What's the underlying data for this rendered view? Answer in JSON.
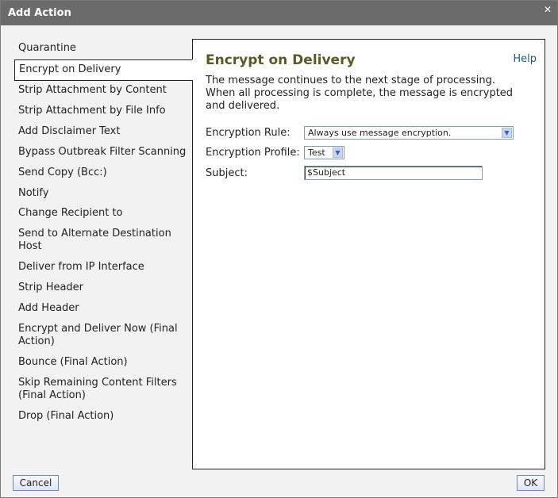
{
  "dialog": {
    "title": "Add Action",
    "close_glyph": "✕"
  },
  "menu": {
    "items": [
      "Quarantine",
      "Encrypt on Delivery",
      "Strip Attachment by Content",
      "Strip Attachment by File Info",
      "Add Disclaimer Text",
      "Bypass Outbreak Filter Scanning",
      "Send Copy (Bcc:)",
      "Notify",
      "Change Recipient to",
      "Send to Alternate Destination Host",
      "Deliver from IP Interface",
      "Strip Header",
      "Add Header",
      "Encrypt and Deliver Now (Final Action)",
      "Bounce (Final Action)",
      "Skip Remaining Content Filters (Final Action)",
      "Drop (Final Action)"
    ],
    "selected_index": 1
  },
  "panel": {
    "heading": "Encrypt on Delivery",
    "help": "Help",
    "description": "The message continues to the next stage of processing. When all processing is complete, the message is encrypted and delivered.",
    "encryption_rule_label": "Encryption Rule:",
    "encryption_rule_value": "Always use message encryption.",
    "encryption_profile_label": "Encryption Profile:",
    "encryption_profile_value": "Test",
    "subject_label": "Subject:",
    "subject_value": "$Subject"
  },
  "footer": {
    "cancel": "Cancel",
    "ok": "OK"
  }
}
